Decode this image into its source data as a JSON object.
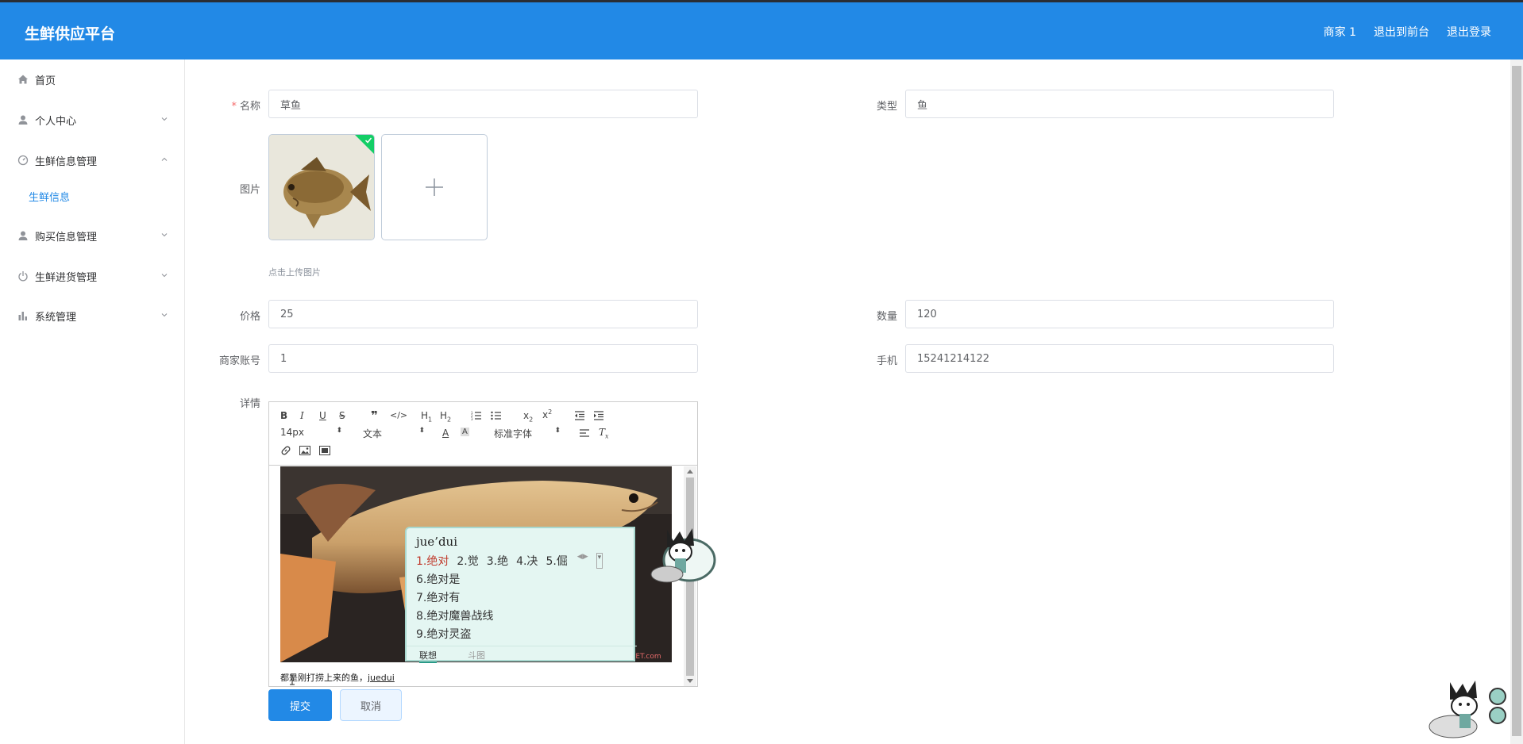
{
  "header": {
    "brand": "生鲜供应平台",
    "links": [
      "商家 1",
      "退出到前台",
      "退出登录"
    ]
  },
  "sidebar": {
    "items": [
      {
        "label": "首页",
        "icon": "home-icon"
      },
      {
        "label": "个人中心",
        "icon": "user-icon"
      },
      {
        "label": "生鲜信息管理",
        "icon": "gauge-icon"
      },
      {
        "label": "购买信息管理",
        "icon": "user-icon"
      },
      {
        "label": "生鲜进货管理",
        "icon": "power-icon"
      },
      {
        "label": "系统管理",
        "icon": "bar-chart-icon"
      }
    ],
    "active_sub": "生鲜信息"
  },
  "form": {
    "name_label": "名称",
    "name_value": "草鱼",
    "type_label": "类型",
    "type_value": "鱼",
    "image_label": "图片",
    "upload_hint": "点击上传图片",
    "price_label": "价格",
    "price_value": "25",
    "qty_label": "数量",
    "qty_value": "120",
    "account_label": "商家账号",
    "account_value": "1",
    "phone_label": "手机",
    "phone_value": "15241214122",
    "detail_label": "详情",
    "submit": "提交",
    "cancel": "取消"
  },
  "editor": {
    "font_size": "14px",
    "block_format": "文本",
    "font_family": "标准字体",
    "text": "都是刚打捞上来的鱼，",
    "composing": "juedui",
    "watermark": "PET.com"
  },
  "ime": {
    "composition": "jue’dui",
    "candidates_row1": [
      "1.绝对",
      "2.觉",
      "3.绝",
      "4.决",
      "5.倔"
    ],
    "candidates_more": [
      "6.绝对是",
      "7.绝对有",
      "8.绝对魔兽战线",
      "9.绝对灵盗"
    ],
    "tabs": [
      "联想",
      "斗图"
    ]
  },
  "colors": {
    "primary": "#2289e6",
    "required": "#f56c6c",
    "ime_bg": "#e4f6f2"
  }
}
